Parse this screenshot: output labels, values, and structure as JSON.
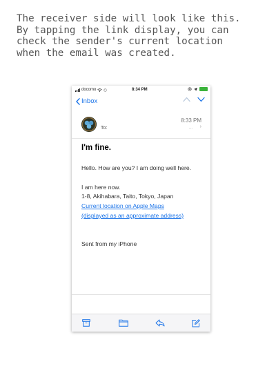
{
  "caption": {
    "lines": [
      "The receiver side will look like this.",
      "By tapping the link display, you can",
      "check the sender's current location",
      "when the email was created."
    ]
  },
  "status_bar": {
    "carrier": "docomo",
    "time": "8:34 PM"
  },
  "nav": {
    "back_label": "Inbox"
  },
  "message": {
    "to_label": "To:",
    "time": "8:33 PM",
    "more": "...",
    "subject": "I'm fine.",
    "greeting": "Hello. How are you? I am doing well here.",
    "here": "I am here now.",
    "address": "1-8, Akihabara, Taito, Tokyo, Japan",
    "link_line1": "Current location on Apple Maps",
    "link_line2": "(displayed as an approximate address)",
    "signature": "Sent from my iPhone"
  },
  "colors": {
    "link": "#1a73e8",
    "battery": "#3bb33b"
  },
  "icons": [
    "back-chevron-icon",
    "up-arrow-icon",
    "down-arrow-icon",
    "archive-icon",
    "folder-icon",
    "reply-icon",
    "compose-icon",
    "wifi-icon",
    "battery-icon"
  ]
}
